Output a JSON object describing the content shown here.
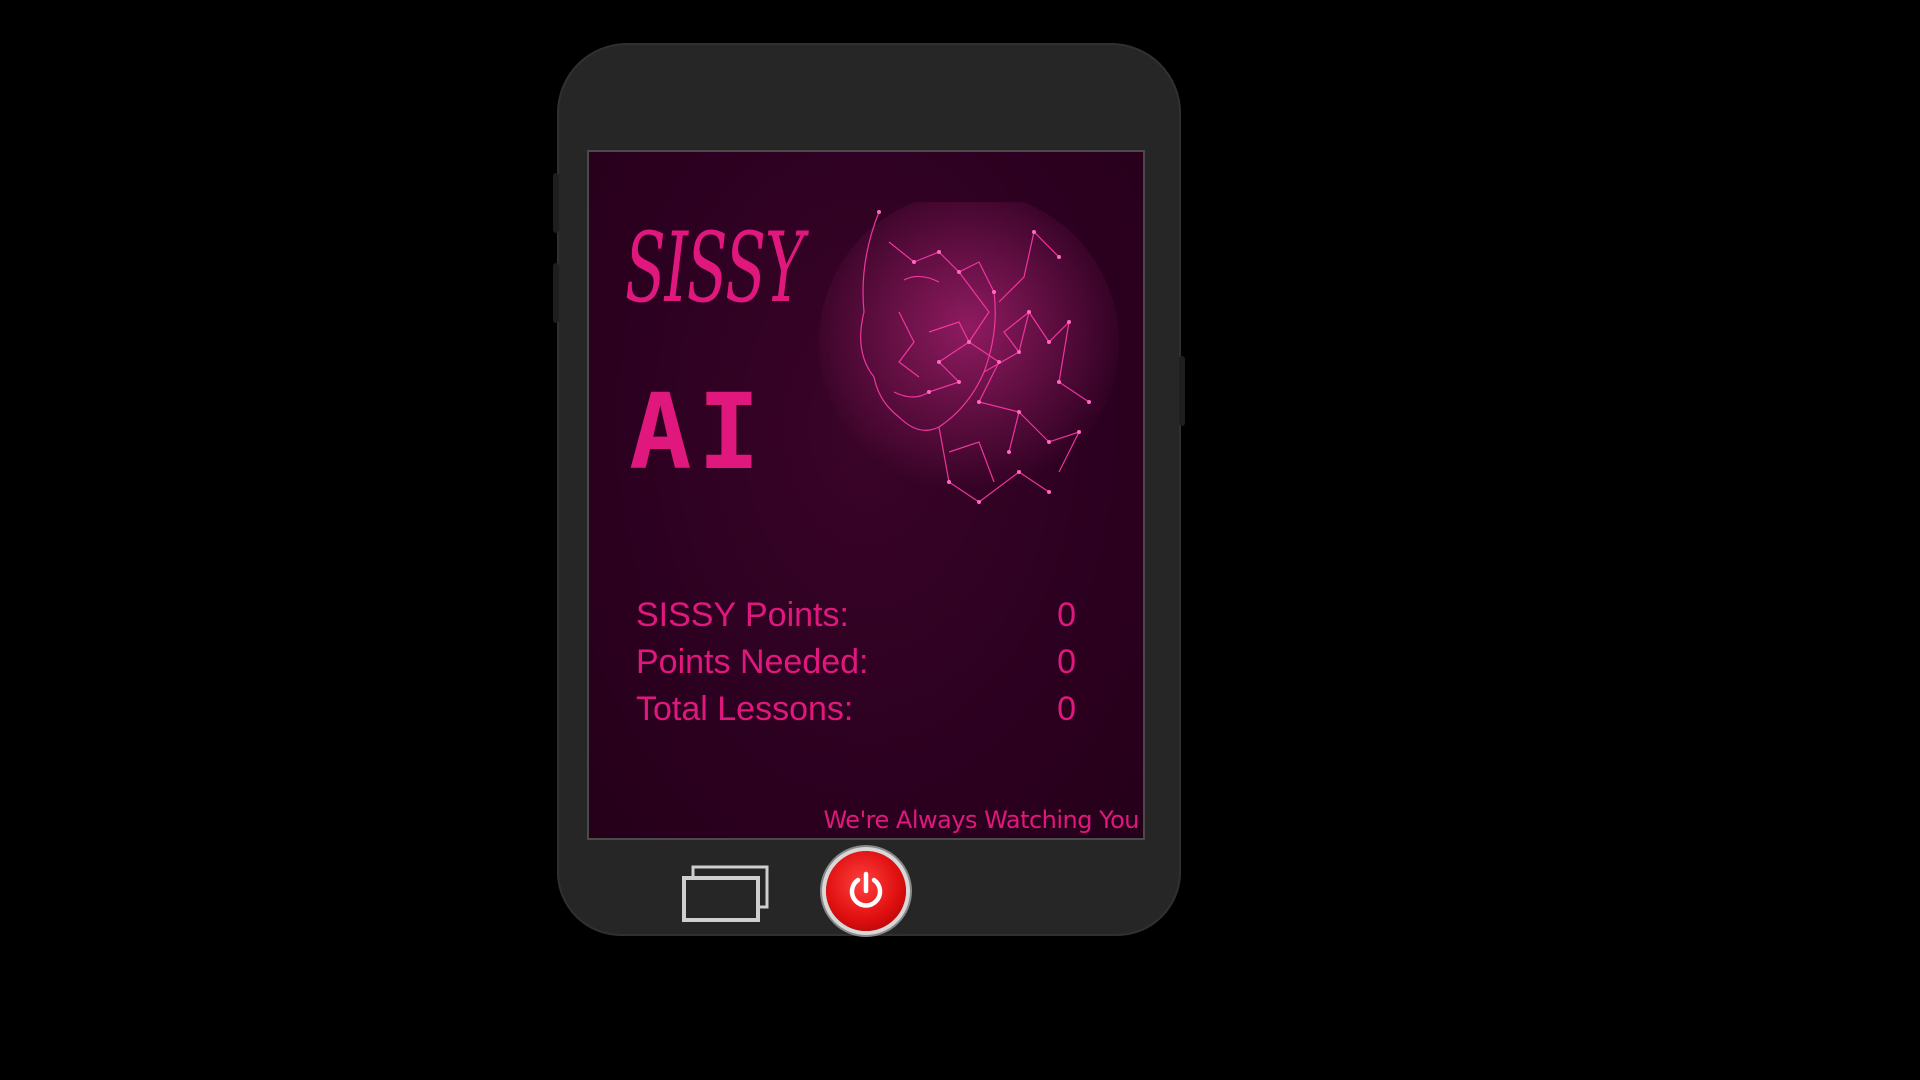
{
  "app": {
    "logo_line1": "SISSY",
    "logo_line2": "AI",
    "tagline": "We're Always Watching You"
  },
  "stats": [
    {
      "label": "SISSY Points:",
      "value": "0"
    },
    {
      "label": "Points Needed:",
      "value": "0"
    },
    {
      "label": "Total Lessons:",
      "value": "0"
    }
  ],
  "icons": {
    "recents": "recent-apps-icon",
    "power": "power-icon",
    "face": "wireframe-face-icon"
  },
  "colors": {
    "accent": "#e0187e",
    "screen_bg": "#2c0020",
    "phone_body": "#262626",
    "power_button": "#e01010"
  }
}
